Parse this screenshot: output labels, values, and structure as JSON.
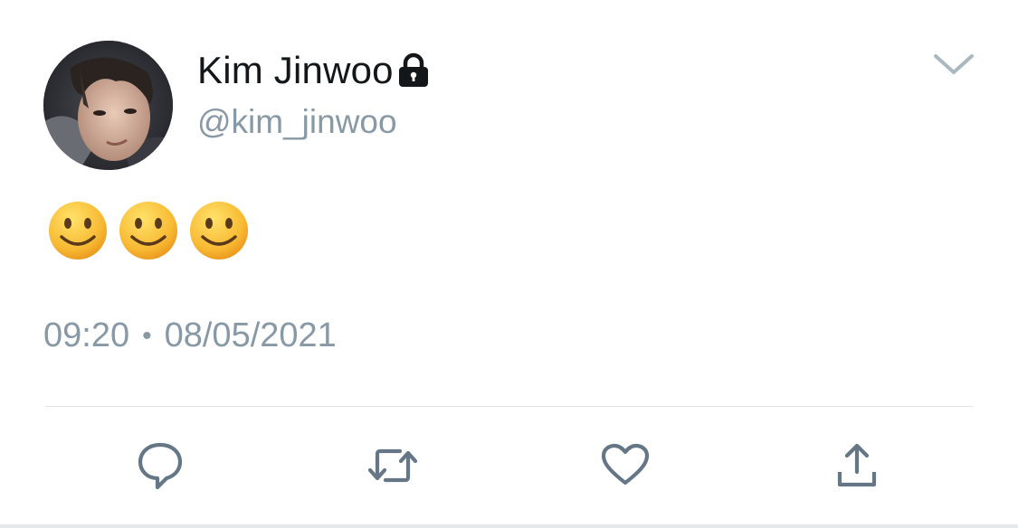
{
  "tweet": {
    "display_name": "Kim Jinwoo",
    "handle": "@kim_jinwoo",
    "protected_icon": "lock-icon",
    "text_emojis": [
      "🙂",
      "🙂",
      "🙂"
    ],
    "time": "09:20",
    "separator": "•",
    "date": "08/05/2021"
  },
  "menu": {
    "icon": "chevron-down-icon"
  },
  "actions": [
    {
      "name": "reply",
      "icon": "speech-bubble-icon"
    },
    {
      "name": "retweet",
      "icon": "retweet-icon"
    },
    {
      "name": "like",
      "icon": "heart-icon"
    },
    {
      "name": "share",
      "icon": "share-icon"
    }
  ],
  "colors": {
    "name_text": "#14171a",
    "secondary_text": "#8899a6",
    "action_icon": "#657786",
    "divider": "#dfe3e6",
    "emoji_face": "#f7b72a"
  }
}
